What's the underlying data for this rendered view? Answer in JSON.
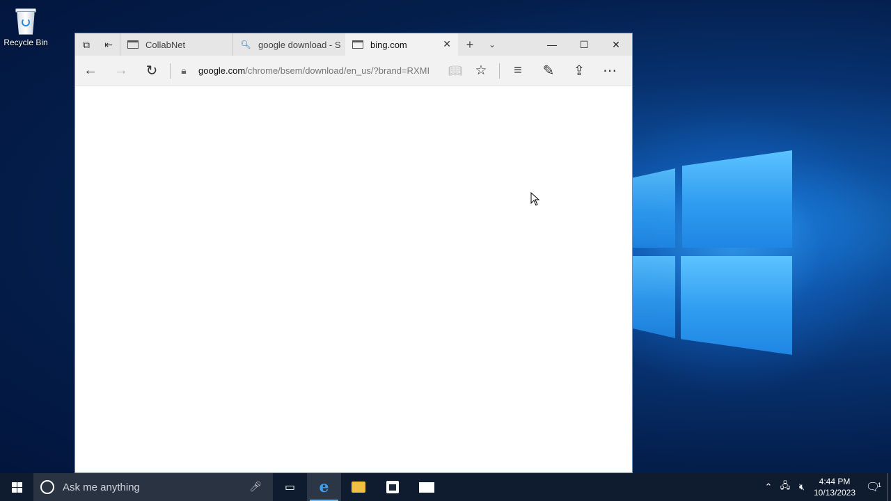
{
  "desktop": {
    "icons": [
      {
        "label": "Recycle Bin",
        "icon": "recycle-bin-icon"
      }
    ]
  },
  "browser": {
    "tabs": [
      {
        "label": "CollabNet",
        "icon": "page-icon",
        "active": false
      },
      {
        "label": "google download - S",
        "icon": "search-icon",
        "active": false
      },
      {
        "label": "bing.com",
        "icon": "page-icon",
        "active": true
      }
    ],
    "url_host": "google.com",
    "url_path": "/chrome/bsem/download/en_us/?brand=RXMI"
  },
  "taskbar": {
    "search_placeholder": "Ask me anything",
    "clock_time": "4:44 PM",
    "clock_date": "10/13/2023",
    "notification_count": "1",
    "accent": "#76b9ed"
  }
}
